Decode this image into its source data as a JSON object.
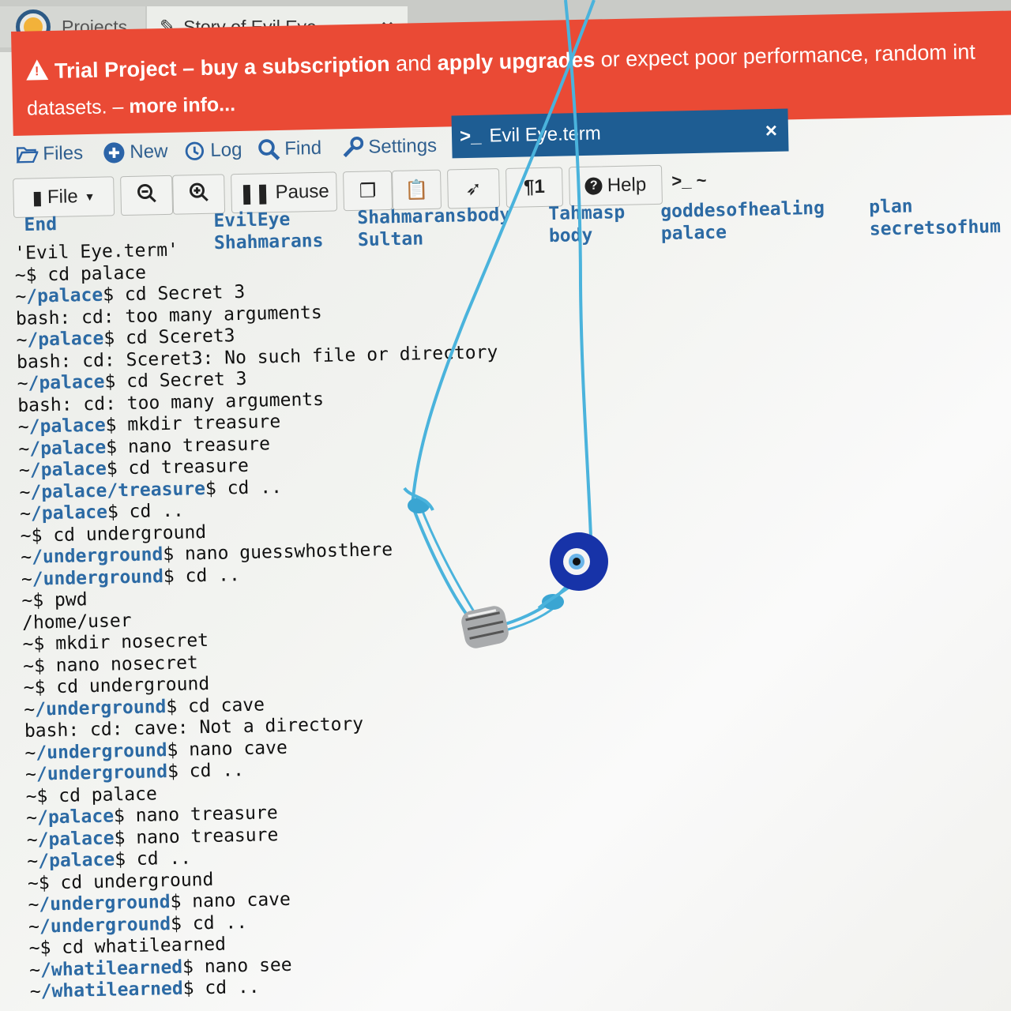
{
  "tabs": [
    {
      "label": "Projects",
      "icon": "cocalc-logo-icon"
    },
    {
      "label": "Story of Evil Eye",
      "icon": "edit-icon",
      "close": "×"
    }
  ],
  "banner": {
    "trial": "Trial Project",
    "dash": " – ",
    "buy": "buy a subscription",
    "and": " and ",
    "apply": "apply upgrades",
    "rest": " or expect poor performance, random int",
    "line2_start": "datasets. – ",
    "more": "more info..."
  },
  "nav": {
    "files": "Files",
    "new": "New",
    "log": "Log",
    "find": "Find",
    "settings": "Settings",
    "term_tab": "Evil Eye.term",
    "term_prompt": ">_",
    "term_close": "×"
  },
  "toolbar": {
    "file": "File",
    "pause": "Pause",
    "help": "Help",
    "prompt": ">_ ~"
  },
  "ls": [
    "End",
    "EvilEye",
    "Shahmaransbody",
    "Tahmasp",
    "goddesofhealing",
    "plan",
    "Shahmarans",
    "Sultan",
    "body",
    "palace",
    "secretsofhum"
  ],
  "terminal": [
    {
      "p": "",
      "t": "'Evil Eye.term'"
    },
    {
      "p": "~$",
      "t": " cd palace"
    },
    {
      "p": "~/palace$",
      "t": " cd Secret 3"
    },
    {
      "p": "",
      "t": "bash: cd: too many arguments"
    },
    {
      "p": "~/palace$",
      "t": " cd Sceret3"
    },
    {
      "p": "",
      "t": "bash: cd: Sceret3: No such file or directory"
    },
    {
      "p": "~/palace$",
      "t": " cd Secret 3"
    },
    {
      "p": "",
      "t": "bash: cd: too many arguments"
    },
    {
      "p": "~/palace$",
      "t": " mkdir treasure"
    },
    {
      "p": "~/palace$",
      "t": " nano treasure"
    },
    {
      "p": "~/palace$",
      "t": " cd treasure"
    },
    {
      "p": "~/palace/treasure$",
      "t": " cd .."
    },
    {
      "p": "~/palace$",
      "t": " cd .."
    },
    {
      "p": "~$",
      "t": " cd underground"
    },
    {
      "p": "~/underground$",
      "t": " nano guesswhosthere"
    },
    {
      "p": "~/underground$",
      "t": " cd .."
    },
    {
      "p": "~$",
      "t": " pwd"
    },
    {
      "p": "",
      "t": "/home/user"
    },
    {
      "p": "~$",
      "t": " mkdir nosecret"
    },
    {
      "p": "~$",
      "t": " nano nosecret"
    },
    {
      "p": "~$",
      "t": " cd underground"
    },
    {
      "p": "~/underground$",
      "t": " cd cave"
    },
    {
      "p": "",
      "t": "bash: cd: cave: Not a directory"
    },
    {
      "p": "~/underground$",
      "t": " nano cave"
    },
    {
      "p": "~/underground$",
      "t": " cd .."
    },
    {
      "p": "~$",
      "t": " cd palace"
    },
    {
      "p": "~/palace$",
      "t": " nano treasure"
    },
    {
      "p": "~/palace$",
      "t": " nano treasure"
    },
    {
      "p": "~/palace$",
      "t": " cd .."
    },
    {
      "p": "~$",
      "t": " cd underground"
    },
    {
      "p": "~/underground$",
      "t": " nano cave"
    },
    {
      "p": "~/underground$",
      "t": " cd .."
    },
    {
      "p": "~$",
      "t": " cd whatilearned"
    },
    {
      "p": "~/whatilearned$",
      "t": " nano see"
    },
    {
      "p": "~/whatilearned$",
      "t": " cd .."
    }
  ],
  "colors": {
    "banner": "#ea4a35",
    "accent": "#2c6aa4",
    "term_tab": "#1e5d93",
    "cord": "#4ab3dc",
    "bead": "#1733a8"
  }
}
